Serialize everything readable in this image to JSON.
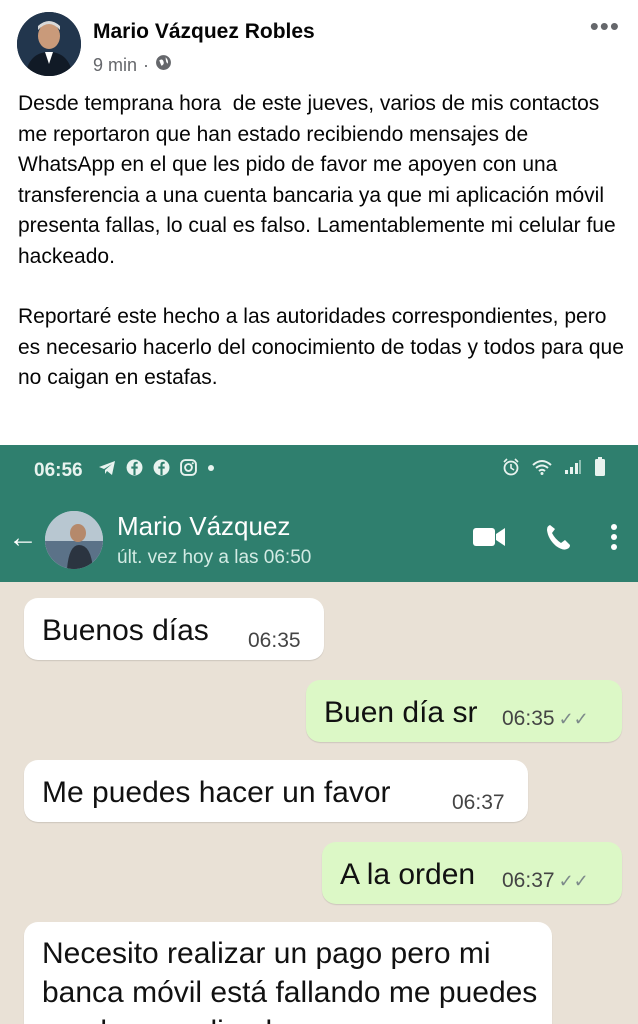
{
  "post": {
    "author": "Mario Vázquez Robles",
    "time": "9 min",
    "visibility_icon": "globe-icon",
    "more_icon": "more-dots-icon",
    "paragraphs": [
      "Desde temprana hora  de este jueves, varios de mis contactos me reportaron que han estado recibiendo mensajes de WhatsApp en el que les pido de favor me apoyen con una transferencia a una cuenta bancaria ya que mi aplicación móvil presenta fallas, lo cual es falso. Lamentablemente mi celular fue hackeado.",
      "Reportaré este hecho a las autoridades correspondientes, pero es necesario hacerlo del conocimiento de todas y todos para que no caigan en estafas."
    ]
  },
  "screenshot": {
    "status_bar": {
      "time": "06:56",
      "left_icons": [
        "telegram-icon",
        "facebook-icon",
        "facebook-icon",
        "instagram-icon",
        "dot-icon"
      ],
      "right_icons": [
        "alarm-icon",
        "wifi-icon",
        "signal-icon",
        "battery-icon"
      ]
    },
    "chat_header": {
      "contact_name": "Mario Vázquez",
      "last_seen": "últ. vez hoy a las 06:50"
    },
    "messages": [
      {
        "direction": "incoming",
        "text": "Buenos días",
        "time": "06:35"
      },
      {
        "direction": "outgoing",
        "text": "Buen día sr",
        "time": "06:35",
        "ticks": "✓✓"
      },
      {
        "direction": "incoming",
        "text": "Me puedes hacer un favor",
        "time": "06:37"
      },
      {
        "direction": "outgoing",
        "text": "A la orden",
        "time": "06:37",
        "ticks": "✓✓"
      },
      {
        "direction": "incoming",
        "text": "Necesito realizar un pago pero mi banca móvil está fallando me puedes ayudar a realizarlo en"
      }
    ],
    "colors": {
      "header_green": "#2f7f6e",
      "chat_bg": "#e9e1d6",
      "outgoing_bubble": "#dcf8c6"
    }
  }
}
